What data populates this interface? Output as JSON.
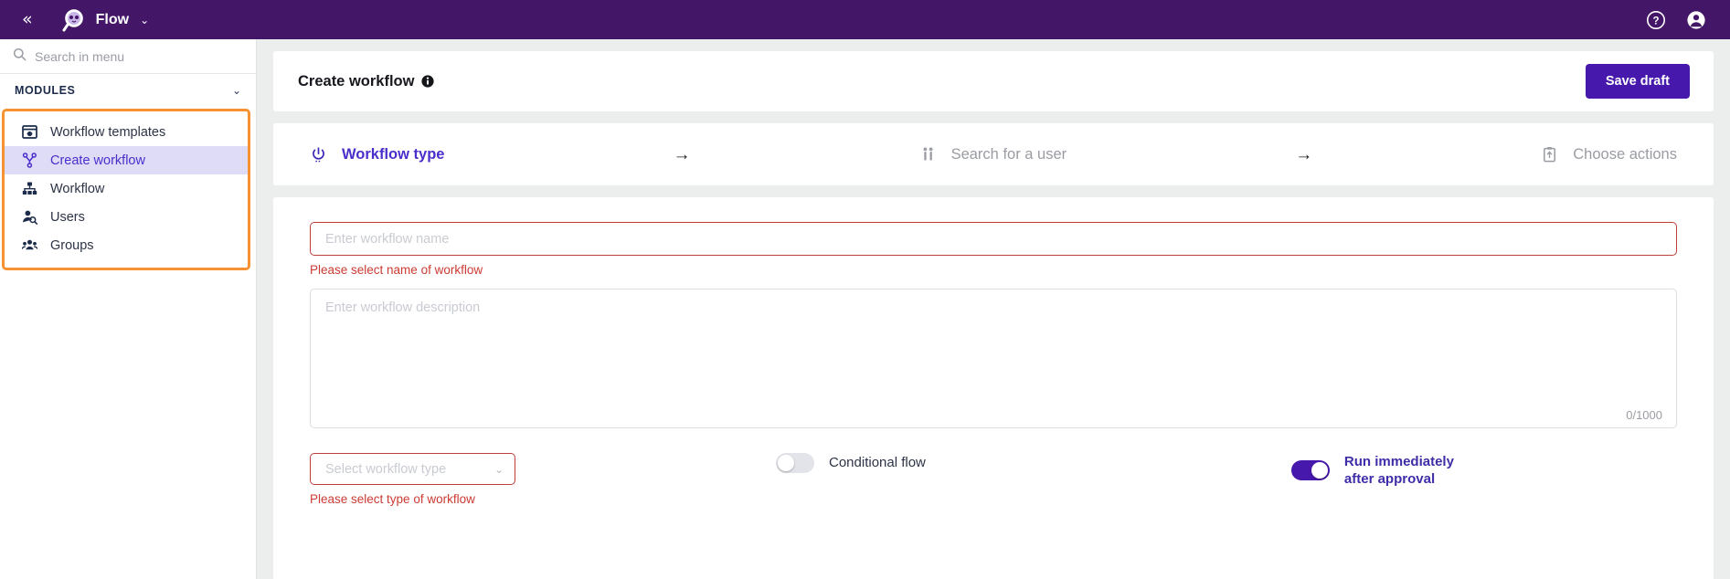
{
  "topbar": {
    "collapse_label": "«",
    "brand_name": "Flow",
    "brand_caret": "⌄",
    "help_icon": "help-circle-icon",
    "account_icon": "account-circle-icon",
    "background": "#431667"
  },
  "sidebar": {
    "search_placeholder": "Search in menu",
    "section_label": "MODULES",
    "section_caret": "⌄",
    "highlight_color": "#f79233",
    "items": [
      {
        "label": "Workflow templates",
        "icon": "workflow-templates-icon",
        "active": false
      },
      {
        "label": "Create workflow",
        "icon": "create-workflow-icon",
        "active": true
      },
      {
        "label": "Workflow",
        "icon": "workflow-hierarchy-icon",
        "active": false
      },
      {
        "label": "Users",
        "icon": "user-search-icon",
        "active": false
      },
      {
        "label": "Groups",
        "icon": "groups-icon",
        "active": false
      }
    ]
  },
  "header": {
    "title": "Create workflow",
    "info_icon": "info-icon",
    "save_draft_label": "Save draft",
    "save_draft_color": "#4718ac"
  },
  "stepper": {
    "arrow": "→",
    "steps": [
      {
        "label": "Workflow type",
        "icon": "power-icon",
        "active": true
      },
      {
        "label": "Search for a user",
        "icon": "people-icon",
        "active": false
      },
      {
        "label": "Choose actions",
        "icon": "clipboard-icon",
        "active": false
      }
    ]
  },
  "form": {
    "name_placeholder": "Enter workflow name",
    "name_value": "",
    "name_error": "Please select name of workflow",
    "description_placeholder": "Enter workflow description",
    "description_value": "",
    "char_count": "0/1000",
    "type_placeholder": "Select workflow type",
    "type_caret": "⌄",
    "type_error": "Please select type of workflow",
    "conditional_flow_label": "Conditional flow",
    "conditional_flow_on": false,
    "run_immediately_line1": "Run immediately",
    "run_immediately_line2": "after approval",
    "run_immediately_on": true,
    "error_color": "#cc3b33"
  }
}
